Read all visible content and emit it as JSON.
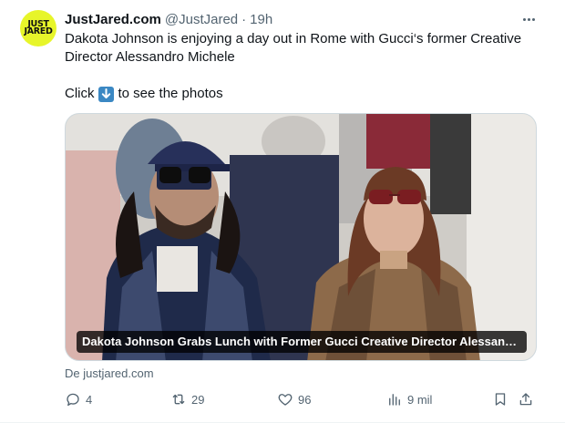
{
  "author": {
    "avatar_text_1": "JUST",
    "avatar_text_2": "JARED",
    "display_name": "JustJared.com",
    "handle": "@JustJared",
    "separator": "·",
    "time": "19h"
  },
  "tweet": {
    "text_line": "Dakota Johnson is enjoying a day out in Rome with Gucci‘s former Creative Director Alessandro Michele",
    "cta_before": "Click",
    "cta_icon": "down-arrow-emoji",
    "cta_after": "to see the photos"
  },
  "card": {
    "title": "Dakota Johnson Grabs Lunch with Former Gucci Creative Director Alessandro M...",
    "source": "De justjared.com"
  },
  "actions": {
    "replies": "4",
    "retweets": "29",
    "likes": "96",
    "views": "9 mil"
  },
  "colors": {
    "avatar_bg": "#e7f52a",
    "muted_text": "#536471",
    "primary_text": "#0f1419",
    "emoji_blue": "#3b88c3"
  }
}
